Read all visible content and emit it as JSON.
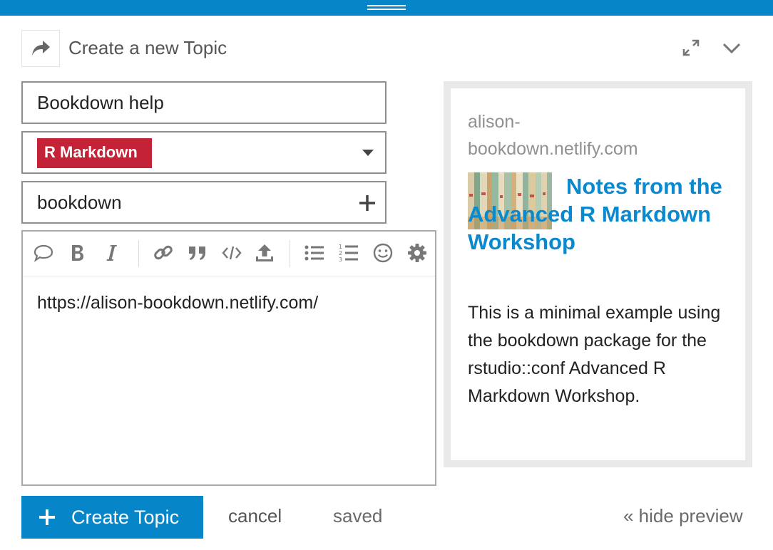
{
  "header": {
    "title": "Create a new Topic"
  },
  "composer": {
    "title_value": "Bookdown help",
    "category": {
      "label": "R Markdown",
      "color": "#c42236"
    },
    "tags_value": "bookdown",
    "body": "https://alison-bookdown.netlify.com/"
  },
  "toolbar": {
    "icons": [
      "quote-bubble-icon",
      "bold-icon",
      "italic-icon",
      "link-icon",
      "blockquote-icon",
      "code-icon",
      "upload-icon",
      "bullet-list-icon",
      "numbered-list-icon",
      "emoji-icon",
      "gear-icon"
    ]
  },
  "preview": {
    "source": "alison-bookdown.netlify.com",
    "title": "Notes from the Advanced R Markdown Workshop",
    "description": "This is a minimal example using the bookdown package for the rstudio::conf Advanced R Markdown Workshop."
  },
  "footer": {
    "create_label": "Create Topic",
    "cancel_label": "cancel",
    "saved_label": "saved",
    "hide_preview_label": "« hide preview"
  },
  "colors": {
    "accent": "#0686c9",
    "link": "#0a89cf"
  }
}
